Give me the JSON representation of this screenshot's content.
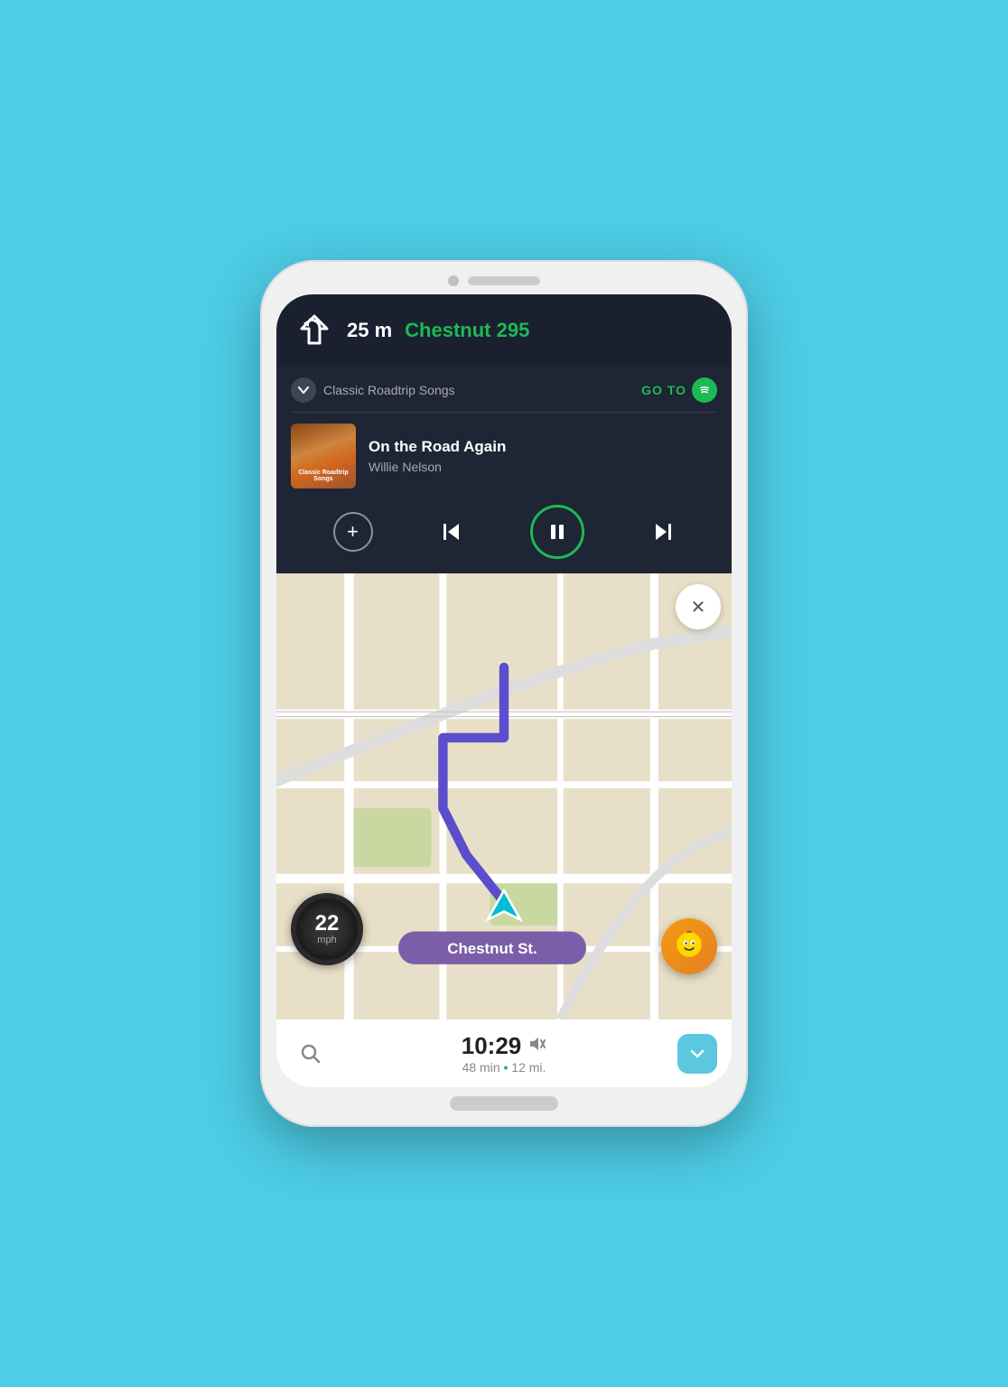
{
  "nav": {
    "distance": "25 m",
    "street": "Chestnut 295",
    "turn_direction": "left"
  },
  "music": {
    "playlist": "Classic Roadtrip Songs",
    "goto_label": "GO TO",
    "track_name": "On the Road Again",
    "artist": "Willie Nelson",
    "album_title": "Classic Roadtrip Songs"
  },
  "controls": {
    "add_label": "+",
    "pause_label": "⏸",
    "prev_label": "⏮",
    "next_label": "⏭"
  },
  "map": {
    "street_label": "Chestnut St.",
    "close_label": "✕"
  },
  "speed": {
    "value": "22",
    "unit": "mph"
  },
  "bottombar": {
    "eta_time": "10:29",
    "duration": "48 min",
    "distance": "12 mi.",
    "separator": "•"
  }
}
